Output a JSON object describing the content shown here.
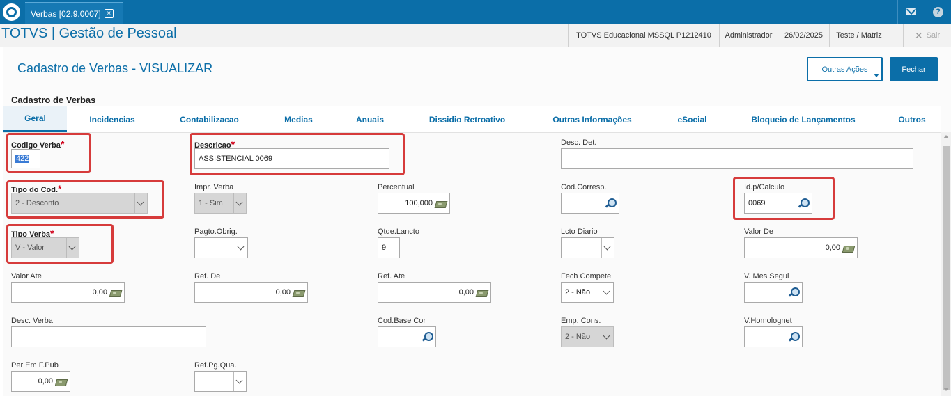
{
  "window_tab": {
    "title": "Verbas [02.9.0007]"
  },
  "header": {
    "app_title": "TOTVS | Gestão de Pessoal",
    "environment": "TOTVS Educacional MSSQL P1212410",
    "user": "Administrador",
    "date": "26/02/2025",
    "branch": "Teste / Matriz",
    "logout_label": "Sair"
  },
  "page": {
    "title": "Cadastro de Verbas - VISUALIZAR",
    "section_title": "Cadastro de Verbas",
    "outras_acoes_label": "Outras Ações",
    "fechar_label": "Fechar"
  },
  "tabs": [
    {
      "label": "Geral",
      "active": true
    },
    {
      "label": "Incidencias"
    },
    {
      "label": "Contabilizacao"
    },
    {
      "label": "Medias"
    },
    {
      "label": "Anuais"
    },
    {
      "label": "Dissidio Retroativo"
    },
    {
      "label": "Outras Informações"
    },
    {
      "label": "eSocial"
    },
    {
      "label": "Bloqueio de Lançamentos"
    },
    {
      "label": "Outros"
    }
  ],
  "fields": {
    "codigo_verba": {
      "label": "Codigo Verba",
      "value": "422"
    },
    "descricao": {
      "label": "Descricao",
      "value": "ASSISTENCIAL  0069"
    },
    "desc_det": {
      "label": "Desc. Det.",
      "value": ""
    },
    "tipo_cod": {
      "label": "Tipo do Cod.",
      "value": "2 - Desconto"
    },
    "impr_verba": {
      "label": "Impr. Verba",
      "value": "1 - Sim"
    },
    "percentual": {
      "label": "Percentual",
      "value": "100,000"
    },
    "cod_corresp": {
      "label": "Cod.Corresp.",
      "value": ""
    },
    "id_calculo": {
      "label": "Id.p/Calculo",
      "value": "0069"
    },
    "tipo_verba": {
      "label": "Tipo Verba",
      "value": "V - Valor"
    },
    "pagto_obrig": {
      "label": "Pagto.Obrig.",
      "value": ""
    },
    "qtde_lancto": {
      "label": "Qtde.Lancto",
      "value": "9"
    },
    "lcto_diario": {
      "label": "Lcto Diario",
      "value": ""
    },
    "valor_de": {
      "label": "Valor De",
      "value": "0,00"
    },
    "valor_ate": {
      "label": "Valor Ate",
      "value": "0,00"
    },
    "ref_de": {
      "label": "Ref. De",
      "value": "0,00"
    },
    "ref_ate": {
      "label": "Ref. Ate",
      "value": "0,00"
    },
    "fech_compete": {
      "label": "Fech Compete",
      "value": "2 - Não"
    },
    "v_mes_segui": {
      "label": "V. Mes Segui",
      "value": ""
    },
    "desc_verba": {
      "label": "Desc. Verba",
      "value": ""
    },
    "cod_base_cor": {
      "label": "Cod.Base Cor",
      "value": ""
    },
    "emp_cons": {
      "label": "Emp. Cons.",
      "value": "2 - Não"
    },
    "v_homolognet": {
      "label": "V.Homolognet",
      "value": ""
    },
    "per_em_fpub": {
      "label": "Per Em F.Pub",
      "value": "0,00"
    },
    "ref_pg_qua": {
      "label": "Ref.Pg.Qua.",
      "value": ""
    }
  },
  "colors": {
    "accent": "#0b6ea8",
    "highlight_box": "#d63b3b",
    "required_star": "#d0021b"
  }
}
